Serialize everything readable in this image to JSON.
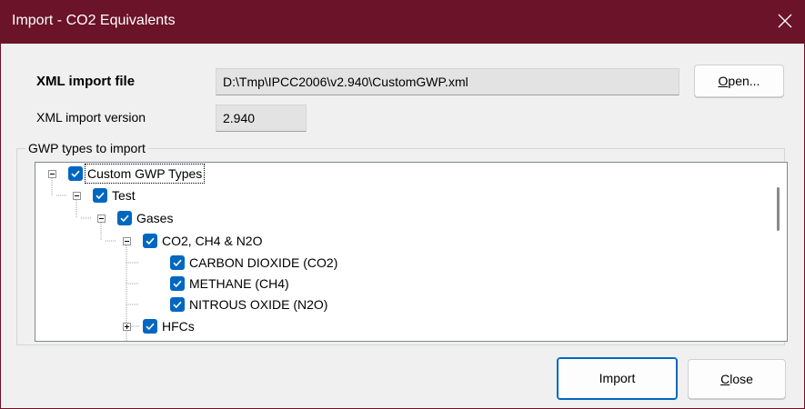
{
  "window": {
    "title": "Import - CO2 Equivalents"
  },
  "form": {
    "xml_file_label": "XML import file",
    "xml_file_value": "D:\\Tmp\\IPCC2006\\v2.940\\CustomGWP.xml",
    "open_label_underlined": "O",
    "open_label_rest": "pen...",
    "xml_version_label": "XML import version",
    "xml_version_value": "2.940"
  },
  "group": {
    "legend": "GWP types to import",
    "tree": [
      {
        "label": "Custom GWP Types",
        "checked": true,
        "expanded": true
      },
      {
        "label": "Test",
        "checked": true,
        "expanded": true
      },
      {
        "label": "Gases",
        "checked": true,
        "expanded": true
      },
      {
        "label": "CO2, CH4 & N2O",
        "checked": true,
        "expanded": true
      },
      {
        "label": "CARBON DIOXIDE (CO2)",
        "checked": true
      },
      {
        "label": "METHANE (CH4)",
        "checked": true
      },
      {
        "label": "NITROUS OXIDE (N2O)",
        "checked": true
      },
      {
        "label": "HFCs",
        "checked": true,
        "expanded": false
      }
    ]
  },
  "buttons": {
    "import_label": "Import",
    "close_label_underlined": "C",
    "close_label_rest": "lose"
  },
  "colors": {
    "titlebar": "#6b1328",
    "checkbox": "#0067c0",
    "accent": "#0067c0"
  }
}
